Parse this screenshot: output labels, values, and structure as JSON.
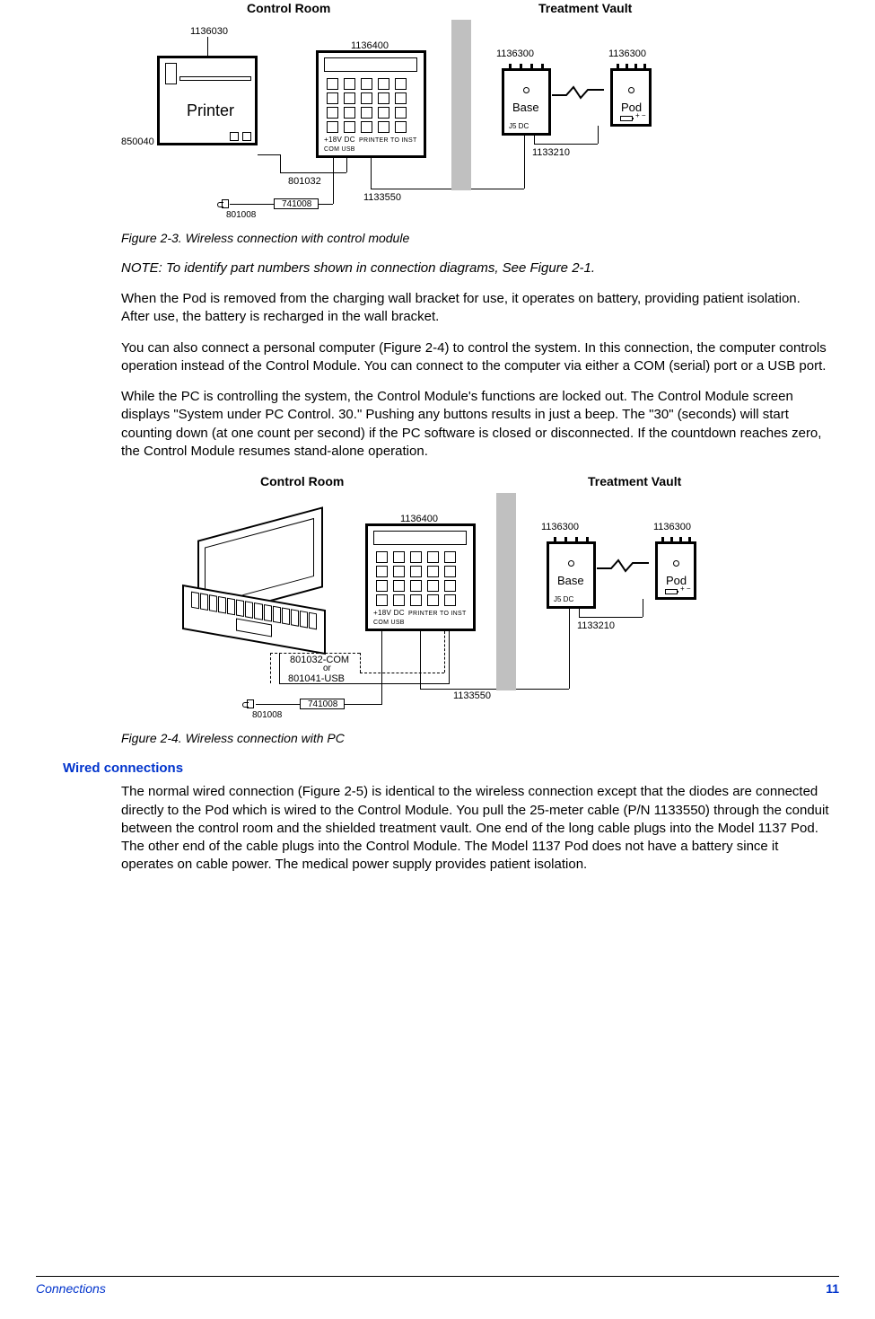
{
  "figure23": {
    "caption": "Figure 2-3. Wireless connection with control module",
    "headers": {
      "control": "Control Room",
      "treatment": "Treatment Vault"
    },
    "part_numbers": {
      "printer_pn": "1136030",
      "printer_box": "850040",
      "printer_label": "Printer",
      "module_pn": "1136400",
      "module_cable": "801032",
      "adapter": "741008",
      "adapter_cable": "801008",
      "long_cable": "1133550",
      "base_pn_left": "1136300",
      "base_pn_right": "1136300",
      "base_link": "1133210",
      "base_label": "Base",
      "base_ports": "J5   DC",
      "pod_label": "Pod",
      "module_ports": "PRINTER  TO INST   COM     USB",
      "module_volt": "+18V DC"
    }
  },
  "paragraphs": {
    "note": "NOTE: To identify part numbers shown in connection diagrams, See Figure 2-1.",
    "p1": "When the Pod is removed from the charging wall bracket for use, it operates on battery, providing patient isolation. After use, the battery is recharged in the wall bracket.",
    "p2": "You can also connect a personal computer (Figure 2-4) to control the system. In this connection, the computer controls operation instead of the Control Module. You can connect to the computer via either a COM (serial) port or a USB port.",
    "p3": "While the PC is controlling the system, the Control Module's functions are locked out. The Control Module screen displays \"System under PC Control. 30.\" Pushing any buttons results in just a beep. The \"30\" (seconds) will start counting down (at one count per second) if the PC software is closed or disconnected. If the countdown reaches zero, the Control Module resumes stand-alone operation."
  },
  "figure24": {
    "caption": "Figure 2-4. Wireless connection with PC",
    "headers": {
      "control": "Control Room",
      "treatment": "Treatment Vault"
    },
    "part_numbers": {
      "module_pn": "1136400",
      "com_cable": "801032-COM",
      "usb_cable": "801041-USB",
      "or_label": "or",
      "adapter": "741008",
      "adapter_cable": "801008",
      "long_cable": "1133550",
      "base_pn_left": "1136300",
      "base_pn_right": "1136300",
      "base_link": "1133210",
      "base_label": "Base",
      "pod_label": "Pod",
      "base_ports": "J5   DC",
      "module_ports": "PRINTER  TO INST   COM     USB",
      "module_volt": "+18V DC"
    }
  },
  "section_heading": "Wired connections",
  "paragraphs2": {
    "p1": "The normal wired connection (Figure 2-5) is identical to the wireless connection except that the diodes are connected directly to the Pod which is wired to the Control Module. You pull the 25-meter cable (P/N 1133550) through the conduit between the control room and the shielded treatment vault. One end of the long cable plugs into the Model 1137 Pod. The other end of the cable plugs into the Control Module. The Model 1137 Pod does not have a battery since it operates on cable power. The medical power supply provides patient isolation."
  },
  "footer": {
    "left": "Connections",
    "right": "11"
  }
}
